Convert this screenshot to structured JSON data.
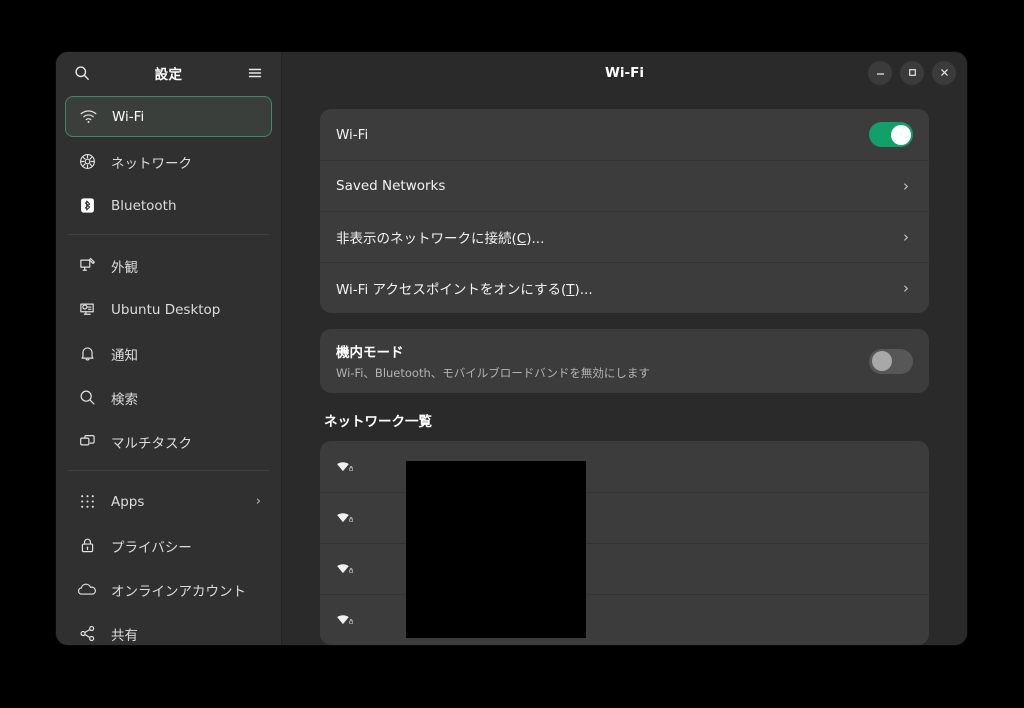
{
  "window": {
    "title": "Wi-Fi",
    "controls": [
      {
        "name": "minimize",
        "glyph": "minimize-icon"
      },
      {
        "name": "maximize",
        "glyph": "maximize-icon"
      },
      {
        "name": "close",
        "glyph": "close-icon"
      }
    ]
  },
  "sidebar": {
    "title": "設定",
    "search_icon": "search-icon",
    "menu_icon": "hamburger-menu-icon",
    "groups": [
      {
        "items": [
          {
            "label": "Wi-Fi",
            "icon": "wifi-icon",
            "selected": true,
            "chevron": ""
          },
          {
            "label": "ネットワーク",
            "icon": "network-icon",
            "selected": false,
            "chevron": ""
          },
          {
            "label": "Bluetooth",
            "icon": "bluetooth-icon",
            "selected": false,
            "chevron": ""
          }
        ]
      },
      {
        "items": [
          {
            "label": "外観",
            "icon": "appearance-icon",
            "selected": false,
            "chevron": ""
          },
          {
            "label": "Ubuntu Desktop",
            "icon": "ubuntu-desktop-icon",
            "selected": false,
            "chevron": ""
          },
          {
            "label": "通知",
            "icon": "bell-icon",
            "selected": false,
            "chevron": ""
          },
          {
            "label": "検索",
            "icon": "search-icon",
            "selected": false,
            "chevron": ""
          },
          {
            "label": "マルチタスク",
            "icon": "multitasking-icon",
            "selected": false,
            "chevron": ""
          }
        ]
      },
      {
        "items": [
          {
            "label": "Apps",
            "icon": "apps-grid-icon",
            "selected": false,
            "chevron": "›"
          },
          {
            "label": "プライバシー",
            "icon": "lock-icon",
            "selected": false,
            "chevron": ""
          },
          {
            "label": "オンラインアカウント",
            "icon": "cloud-icon",
            "selected": false,
            "chevron": ""
          },
          {
            "label": "共有",
            "icon": "share-icon",
            "selected": false,
            "chevron": ""
          }
        ]
      }
    ]
  },
  "main": {
    "wifi_card": {
      "rows": [
        {
          "label": "Wi-Fi",
          "type": "toggle",
          "toggle_state": "on"
        },
        {
          "label": "Saved Networks",
          "type": "chevron",
          "chevron": "›"
        },
        {
          "label_pre": "非表示のネットワークに接続(",
          "mnemonic": "C",
          "label_post": ")...",
          "type": "chevron",
          "chevron": "›"
        },
        {
          "label_pre": "Wi-Fi アクセスポイントをオンにする(",
          "mnemonic": "T",
          "label_post": ")...",
          "type": "chevron",
          "chevron": "›"
        }
      ]
    },
    "airplane": {
      "title": "機内モード",
      "subtitle": "Wi-Fi、Bluetooth、モバイルブロードバンドを無効にします",
      "toggle_state": "off"
    },
    "networks_section_title": "ネットワーク一覧",
    "networks": [
      {
        "name": "",
        "icon": "wifi-signal-icon",
        "secure_icon": "lock-small-icon"
      },
      {
        "name": "",
        "icon": "wifi-signal-icon",
        "secure_icon": "lock-small-icon"
      },
      {
        "name": "",
        "icon": "wifi-signal-icon",
        "secure_icon": "lock-small-icon"
      },
      {
        "name": "",
        "icon": "wifi-signal-icon",
        "secure_icon": "lock-small-icon"
      }
    ]
  },
  "colors": {
    "accent_green": "#12a06a",
    "selected_border": "#3d8a68",
    "card_bg": "#3c3c3c",
    "window_bg": "#2a2a2a",
    "sidebar_bg": "#303030",
    "desktop_bg": "#000000"
  }
}
